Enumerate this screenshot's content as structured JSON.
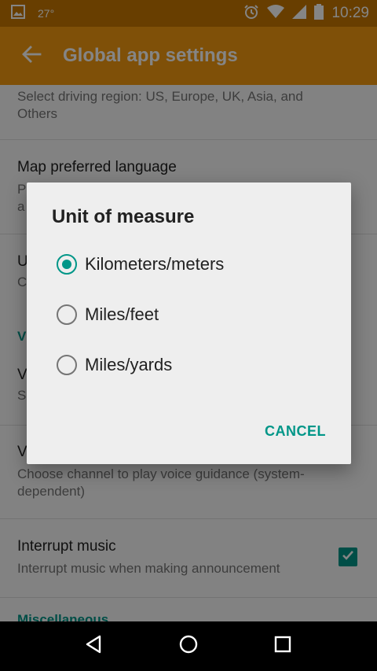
{
  "status_bar": {
    "temperature": "27°",
    "time": "10:29",
    "icons": [
      "image-icon",
      "alarm-icon",
      "wifi-icon",
      "signal-icon",
      "battery-icon"
    ]
  },
  "app_bar": {
    "title": "Global app settings",
    "color": "#f39a10"
  },
  "settings": {
    "region_summary_1": "Select driving region: US, Europe, UK, Asia, and",
    "region_summary_2": "Others",
    "map_language_title": "Map preferred language",
    "map_language_summary_1": "P",
    "map_language_summary_2": "a",
    "units_title": "U",
    "units_summary": "C",
    "section_voice": "V",
    "voice_title": "V",
    "voice_summary": "S",
    "voice_channel_title": "V",
    "voice_channel_summary_1": "Choose channel to play voice guidance (system-",
    "voice_channel_summary_2": "dependent)",
    "interrupt_music_title": "Interrupt music",
    "interrupt_music_summary": "Interrupt music when making announcement",
    "interrupt_music_checked": true,
    "section_misc": "Miscellaneous"
  },
  "dialog": {
    "title": "Unit of measure",
    "options": [
      {
        "label": "Kilometers/meters",
        "selected": true
      },
      {
        "label": "Miles/feet",
        "selected": false
      },
      {
        "label": "Miles/yards",
        "selected": false
      }
    ],
    "cancel_label": "CANCEL",
    "accent_color": "#009688"
  },
  "nav_bar": {
    "buttons": [
      "back-icon",
      "home-icon",
      "recents-icon"
    ]
  }
}
